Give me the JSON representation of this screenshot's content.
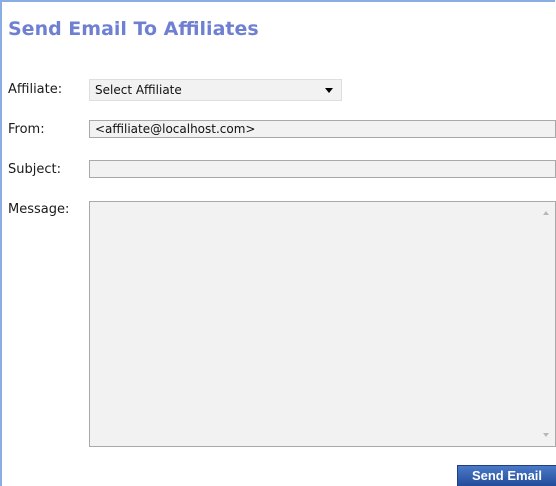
{
  "form": {
    "title": "Send Email To Affiliates",
    "affiliate": {
      "label": "Affiliate:",
      "selected": "Select Affiliate"
    },
    "from": {
      "label": "From:",
      "value": "<affiliate@localhost.com>"
    },
    "subject": {
      "label": "Subject:",
      "value": ""
    },
    "message": {
      "label": "Message:",
      "value": ""
    },
    "send_label": "Send Email"
  },
  "icons": {
    "select_arrow": "chevron-down-icon",
    "scroll_up": "scroll-up-arrow-icon",
    "scroll_down": "scroll-down-arrow-icon"
  },
  "colors": {
    "title": "#6f80d2",
    "panel_border": "#8aaee3",
    "button": "#2f5fb0",
    "field_bg": "#f2f2f2"
  }
}
